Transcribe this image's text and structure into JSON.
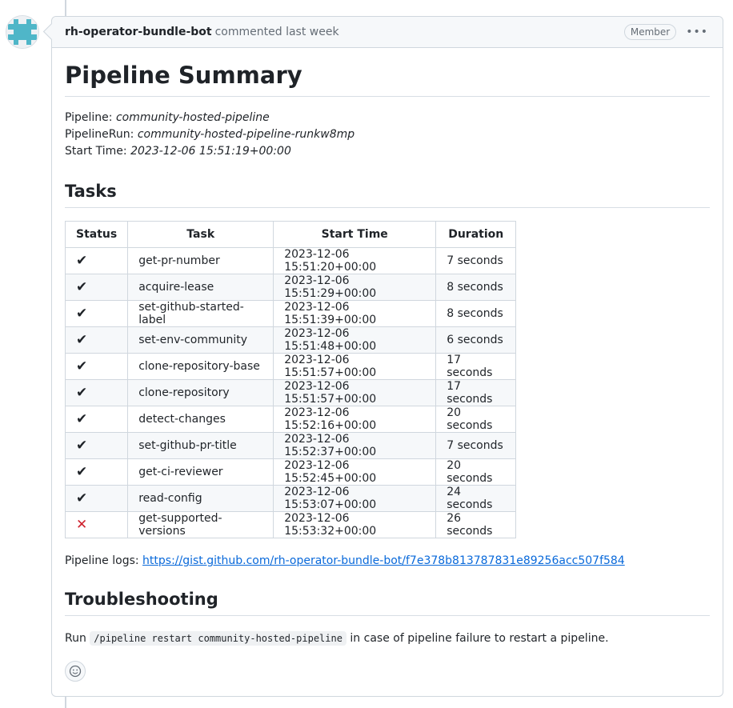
{
  "comment": {
    "author": "rh-operator-bundle-bot",
    "action": "commented last week",
    "badge": "Member",
    "more_label": "•••"
  },
  "content": {
    "title": "Pipeline Summary",
    "pipeline_label": "Pipeline: ",
    "pipeline_value": "community-hosted-pipeline",
    "run_label": "PipelineRun: ",
    "run_value": "community-hosted-pipeline-runkw8mp",
    "start_label": "Start Time: ",
    "start_value": "2023-12-06 15:51:19+00:00",
    "tasks_heading": "Tasks",
    "table": {
      "headers": [
        "Status",
        "Task",
        "Start Time",
        "Duration"
      ],
      "rows": [
        {
          "status": "success",
          "status_glyph": "✔",
          "task": "get-pr-number",
          "start": "2023-12-06 15:51:20+00:00",
          "duration": "7 seconds"
        },
        {
          "status": "success",
          "status_glyph": "✔",
          "task": "acquire-lease",
          "start": "2023-12-06 15:51:29+00:00",
          "duration": "8 seconds"
        },
        {
          "status": "success",
          "status_glyph": "✔",
          "task": "set-github-started-label",
          "start": "2023-12-06 15:51:39+00:00",
          "duration": "8 seconds"
        },
        {
          "status": "success",
          "status_glyph": "✔",
          "task": "set-env-community",
          "start": "2023-12-06 15:51:48+00:00",
          "duration": "6 seconds"
        },
        {
          "status": "success",
          "status_glyph": "✔",
          "task": "clone-repository-base",
          "start": "2023-12-06 15:51:57+00:00",
          "duration": "17 seconds"
        },
        {
          "status": "success",
          "status_glyph": "✔",
          "task": "clone-repository",
          "start": "2023-12-06 15:51:57+00:00",
          "duration": "17 seconds"
        },
        {
          "status": "success",
          "status_glyph": "✔",
          "task": "detect-changes",
          "start": "2023-12-06 15:52:16+00:00",
          "duration": "20 seconds"
        },
        {
          "status": "success",
          "status_glyph": "✔",
          "task": "set-github-pr-title",
          "start": "2023-12-06 15:52:37+00:00",
          "duration": "7 seconds"
        },
        {
          "status": "success",
          "status_glyph": "✔",
          "task": "get-ci-reviewer",
          "start": "2023-12-06 15:52:45+00:00",
          "duration": "20 seconds"
        },
        {
          "status": "success",
          "status_glyph": "✔",
          "task": "read-config",
          "start": "2023-12-06 15:53:07+00:00",
          "duration": "24 seconds"
        },
        {
          "status": "failure",
          "status_glyph": "✕",
          "task": "get-supported-versions",
          "start": "2023-12-06 15:53:32+00:00",
          "duration": "26 seconds"
        }
      ]
    },
    "logs_label": "Pipeline logs: ",
    "logs_url": "https://gist.github.com/rh-operator-bundle-bot/f7e378b813787831e89256acc507f584",
    "troubleshooting_heading": "Troubleshooting",
    "run_prefix": "Run ",
    "run_code": "/pipeline restart community-hosted-pipeline",
    "run_suffix": " in case of pipeline failure to restart a pipeline."
  },
  "icons": {
    "avatar": "identicon-avatar",
    "reaction": "smiley-icon"
  },
  "colors": {
    "link": "#0969da",
    "failure": "#cf222e",
    "avatar_teal": "#4fb6c8"
  }
}
